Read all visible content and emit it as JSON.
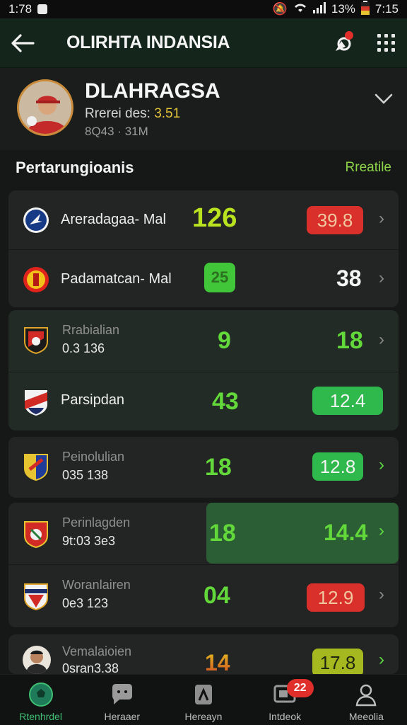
{
  "status": {
    "time_left": "1:78",
    "battery": "13%",
    "time_right": "7:15"
  },
  "appbar": {
    "title": "OLIRHTA INDANSIA"
  },
  "profile": {
    "name": "DLAHRAGSA",
    "subtitle_label": "Rrerei des:",
    "subtitle_value": "3.51",
    "number": "8Q43 · 31M",
    "icon": "chevron-down-icon"
  },
  "section": {
    "title": "Pertarungioanis",
    "link": "Rreatile"
  },
  "rows": [
    {
      "name": "Areradagaa- Mal",
      "score": "126",
      "value": "39.8",
      "value_color": "#d9302b"
    },
    {
      "name": "Padamatcan- Mal",
      "score": "25",
      "value": "38"
    },
    {
      "name": "Rrabialian",
      "sub": "0.3 136",
      "score": "9",
      "value": "18"
    },
    {
      "name": "Parsipdan",
      "score": "43",
      "value": "12.4",
      "value_color": "#2fb84b"
    },
    {
      "name": "Peinolulian",
      "sub": "035 138",
      "score": "18",
      "value": "12.8",
      "value_color": "#2fb84b"
    },
    {
      "name": "Perinlagden",
      "sub": "9t:03 3e3",
      "score": "18",
      "value": "14.4"
    },
    {
      "name": "Woranlairen",
      "sub": "0e3 123",
      "score": "04",
      "value": "12.9",
      "value_color": "#d9302b"
    },
    {
      "name": "Vemalaioien",
      "sub": "0sran3.38",
      "score": "14",
      "value": "17.8",
      "value_color": "#a6b81f"
    }
  ],
  "nav": [
    {
      "label": "Rtenhrdel",
      "icon": "soccer-ball-icon"
    },
    {
      "label": "Heraaer",
      "icon": "chat-bubble-icon"
    },
    {
      "label": "Hereayn",
      "icon": "trophy-icon"
    },
    {
      "label": "Intdeok",
      "icon": "inbox-icon",
      "badge": "22"
    },
    {
      "label": "Meeolia",
      "icon": "person-icon"
    }
  ]
}
